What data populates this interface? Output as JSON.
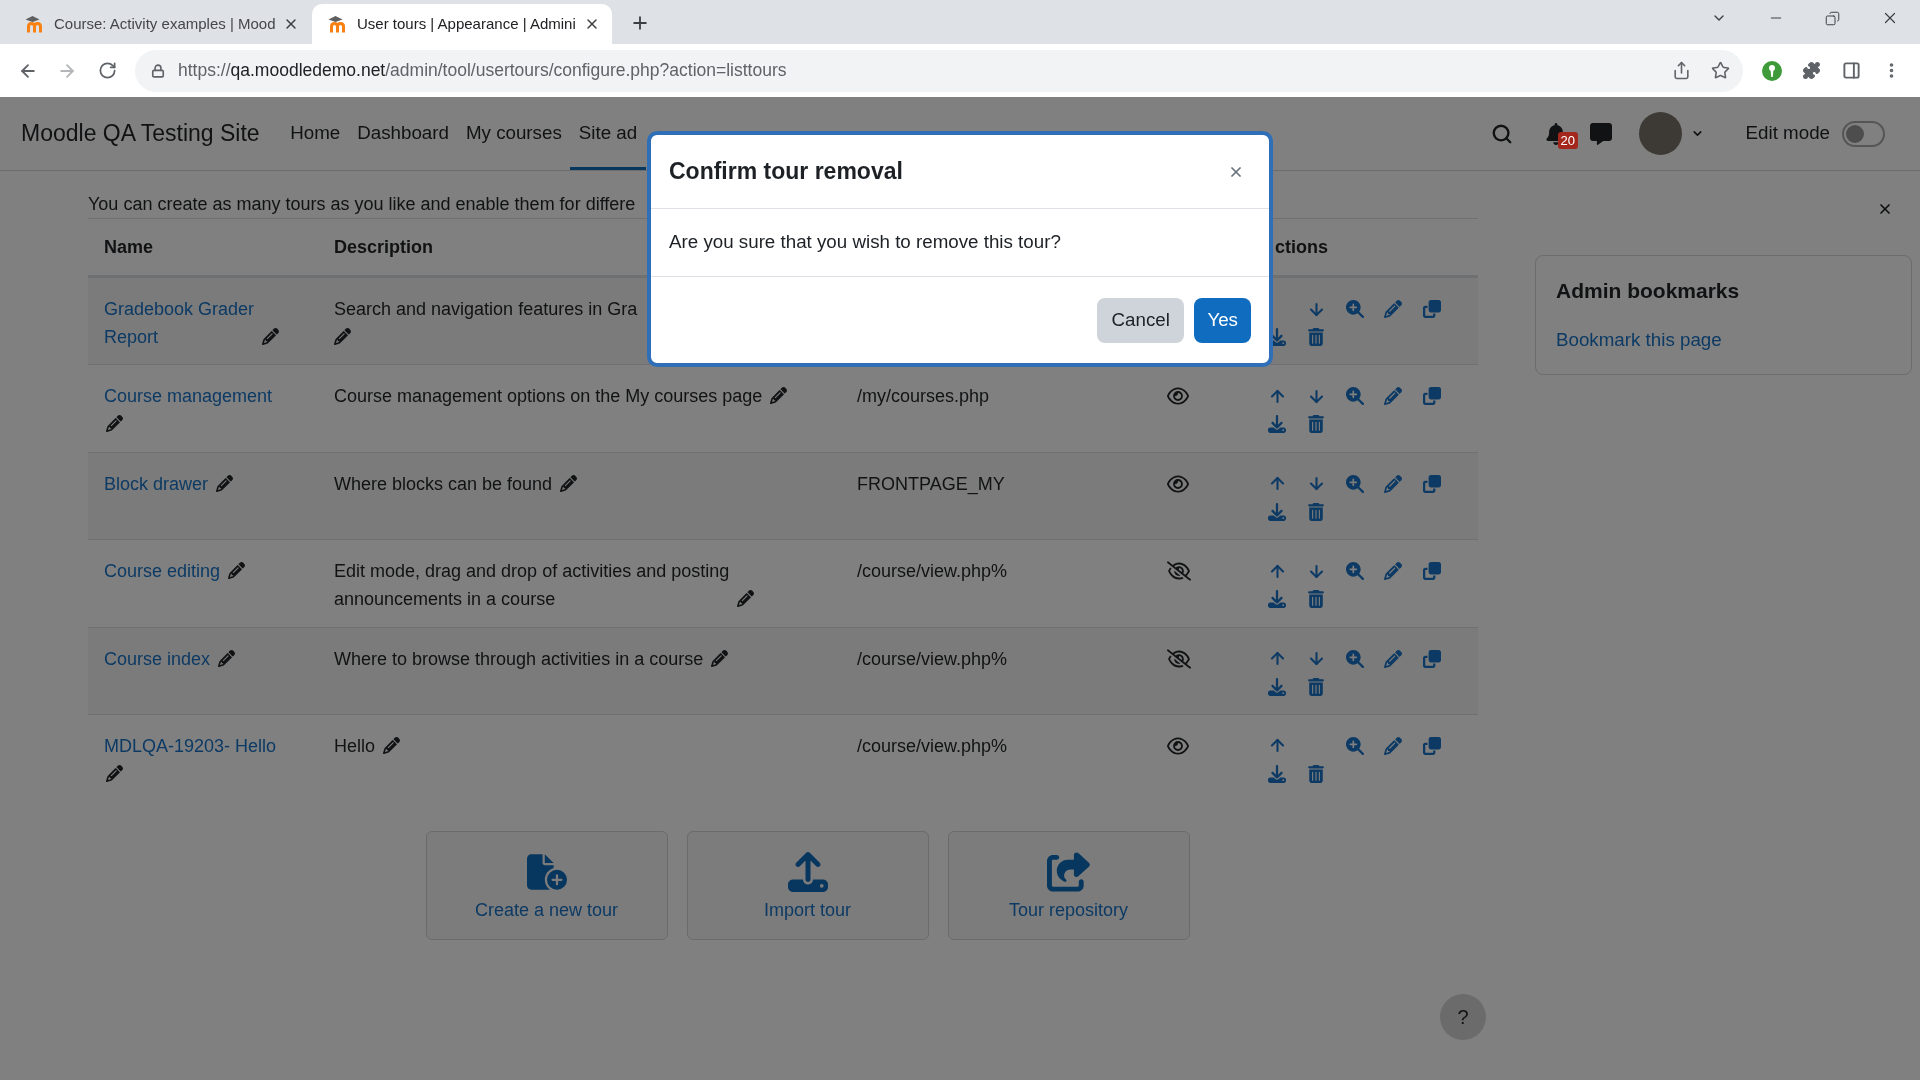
{
  "browser": {
    "tabs": [
      {
        "title": "Course: Activity examples | Mood",
        "selected": false
      },
      {
        "title": "User tours | Appearance | Admini",
        "selected": true
      }
    ],
    "url": {
      "scheme": "https://",
      "host": "qa.moodledemo.net",
      "path": "/admin/tool/usertours/configure.php?action=listtours"
    }
  },
  "navbar": {
    "site_name": "Moodle QA Testing Site",
    "links": [
      {
        "label": "Home",
        "selected": false
      },
      {
        "label": "Dashboard",
        "selected": false
      },
      {
        "label": "My courses",
        "selected": false
      },
      {
        "label": "Site ad",
        "selected": true
      }
    ],
    "notification_count": "20",
    "edit_mode": {
      "label": "Edit mode",
      "on": false
    }
  },
  "intro": "You can create as many tours as you like and enable them for differe",
  "table": {
    "columns": {
      "name": "Name",
      "description": "Description",
      "actions": "ctions"
    },
    "rows": [
      {
        "name": "Gradebook Grader Report",
        "description": {
          "text": "Search and navigation features in Gra",
          "covered": true
        },
        "actions": [
          {
            "kind": "move_down"
          },
          {
            "kind": "view"
          },
          {
            "kind": "edit"
          },
          {
            "kind": "duplicate"
          },
          {
            "kind": "export"
          },
          {
            "kind": "delete"
          }
        ]
      },
      {
        "name": "Course management",
        "description": {
          "text": "Course management options on the My courses page",
          "covered": false
        },
        "url": "/my/courses.php",
        "enabled": true,
        "actions": [
          {
            "kind": "move_up"
          },
          {
            "kind": "move_down"
          },
          {
            "kind": "view"
          },
          {
            "kind": "edit"
          },
          {
            "kind": "duplicate"
          },
          {
            "kind": "export"
          },
          {
            "kind": "delete"
          }
        ]
      },
      {
        "name": "Block drawer",
        "description": {
          "text": "Where blocks can be found",
          "covered": false
        },
        "url": "FRONTPAGE_MY",
        "enabled": true,
        "actions": [
          {
            "kind": "move_up"
          },
          {
            "kind": "move_down"
          },
          {
            "kind": "view"
          },
          {
            "kind": "edit"
          },
          {
            "kind": "duplicate"
          },
          {
            "kind": "export"
          },
          {
            "kind": "delete"
          }
        ]
      },
      {
        "name": "Course editing",
        "description": {
          "text": "Edit mode, drag and drop of activities and posting announcements in a course",
          "covered": false
        },
        "url": "/course/view.php%",
        "enabled": false,
        "actions": [
          {
            "kind": "move_up"
          },
          {
            "kind": "move_down"
          },
          {
            "kind": "view"
          },
          {
            "kind": "edit"
          },
          {
            "kind": "duplicate"
          },
          {
            "kind": "export"
          },
          {
            "kind": "delete"
          }
        ]
      },
      {
        "name": "Course index",
        "description": {
          "text": "Where to browse through activities in a course",
          "covered": false
        },
        "url": "/course/view.php%",
        "enabled": false,
        "actions": [
          {
            "kind": "move_up"
          },
          {
            "kind": "move_down"
          },
          {
            "kind": "view"
          },
          {
            "kind": "edit"
          },
          {
            "kind": "duplicate"
          },
          {
            "kind": "export"
          },
          {
            "kind": "delete"
          }
        ]
      },
      {
        "name": "MDLQA-19203- Hello",
        "description": {
          "text": "Hello",
          "covered": false
        },
        "url": "/course/view.php%",
        "enabled": true,
        "actions": [
          {
            "kind": "move_up"
          },
          {
            "kind": "view"
          },
          {
            "kind": "edit"
          },
          {
            "kind": "duplicate"
          },
          {
            "kind": "export"
          },
          {
            "kind": "delete"
          }
        ]
      }
    ]
  },
  "buttons": [
    {
      "kind": "create",
      "label": "Create a new tour"
    },
    {
      "kind": "import",
      "label": "Import tour"
    },
    {
      "kind": "repository",
      "label": "Tour repository"
    }
  ],
  "drawer": {
    "block_title": "Admin bookmarks",
    "link": "Bookmark this page"
  },
  "dialog": {
    "title": "Confirm tour removal",
    "message": "Are you sure that you wish to remove this tour?",
    "buttons": [
      {
        "kind": "secondary",
        "label": "Cancel"
      },
      {
        "kind": "primary",
        "label": "Yes"
      }
    ]
  },
  "help_button": "?"
}
